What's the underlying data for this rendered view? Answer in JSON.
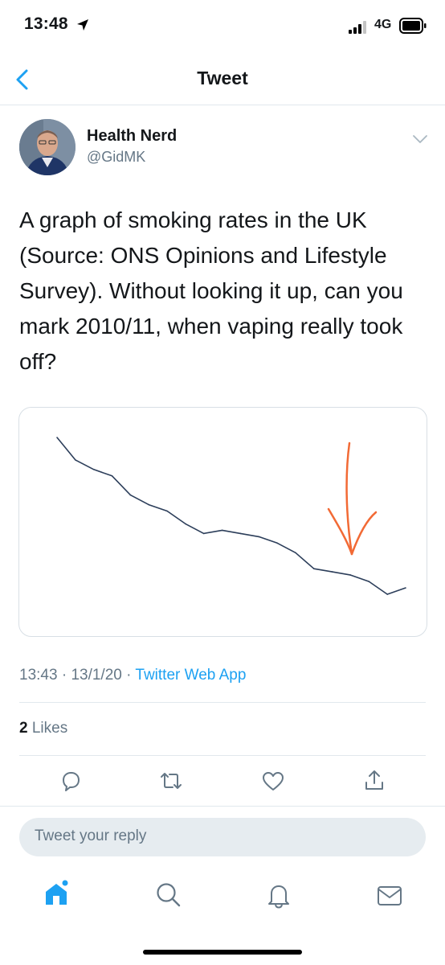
{
  "status_bar": {
    "time": "13:48",
    "network": "4G"
  },
  "nav": {
    "title": "Tweet"
  },
  "author": {
    "name": "Health Nerd",
    "handle": "@GidMK"
  },
  "tweet": {
    "lines": [
      "A graph of smoking rates in the UK",
      "(Source: ONS Opinions and Lifestyle",
      "Survey). Without looking it up, can you",
      "mark 2010/11, when vaping really took",
      "off?"
    ],
    "time": "13:43",
    "date": "13/1/20",
    "client": "Twitter Web App",
    "separator": "·",
    "likes_count": "2",
    "likes_label": "Likes"
  },
  "chart_data": {
    "type": "line",
    "title": "",
    "xlabel": "",
    "ylabel": "",
    "axes_shown": false,
    "grid": false,
    "legend": "none",
    "series": [
      {
        "color": "#2c3e5a",
        "values": [
          100,
          93,
          90,
          88,
          82,
          79,
          77,
          73,
          70,
          71,
          70,
          69,
          67,
          64,
          59,
          58,
          57,
          55,
          51,
          53
        ]
      }
    ],
    "annotation": {
      "type": "hand-drawn arrow pointing down",
      "color": "#f26a35"
    }
  },
  "reply": {
    "placeholder": "Tweet your reply"
  },
  "colors": {
    "accent": "#1da1f2",
    "text_secondary": "#657786",
    "arrow": "#f26a35",
    "line": "#2c3e5a"
  },
  "icons": {
    "actions": [
      "comment-icon",
      "retweet-icon",
      "like-icon",
      "share-icon"
    ],
    "tabs": [
      "home-icon",
      "search-icon",
      "notifications-icon",
      "messages-icon"
    ]
  }
}
